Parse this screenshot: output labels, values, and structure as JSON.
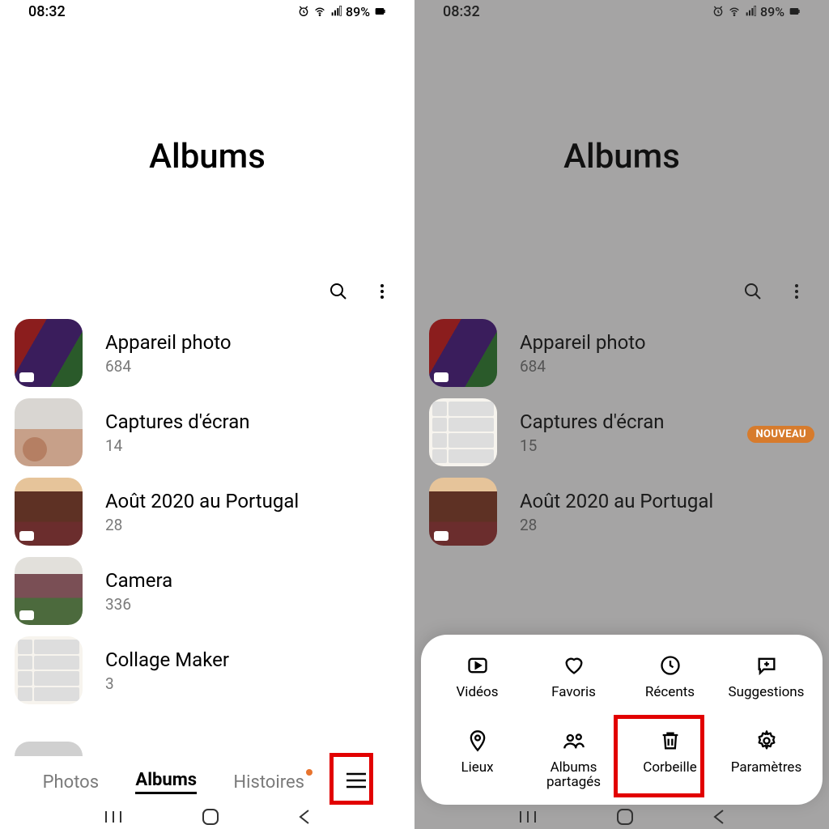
{
  "status": {
    "time": "08:32",
    "battery": "89%"
  },
  "title": "Albums",
  "albums_left": [
    {
      "name": "Appareil photo",
      "count": "684"
    },
    {
      "name": "Captures d'écran",
      "count": "14"
    },
    {
      "name": "Août 2020 au Portugal",
      "count": "28"
    },
    {
      "name": "Camera",
      "count": "336"
    },
    {
      "name": "Collage Maker",
      "count": "3"
    }
  ],
  "albums_right": [
    {
      "name": "Appareil photo",
      "count": "684"
    },
    {
      "name": "Captures d'écran",
      "count": "15"
    },
    {
      "name": "Août 2020 au Portugal",
      "count": "28"
    }
  ],
  "badge_new": "NOUVEAU",
  "tabs": {
    "photos": "Photos",
    "albums": "Albums",
    "histoires": "Histoires"
  },
  "sheet": {
    "videos": "Vidéos",
    "favoris": "Favoris",
    "recents": "Récents",
    "suggestions": "Suggestions",
    "lieux": "Lieux",
    "albums_partages": "Albums partagés",
    "corbeille": "Corbeille",
    "parametres": "Paramètres"
  }
}
